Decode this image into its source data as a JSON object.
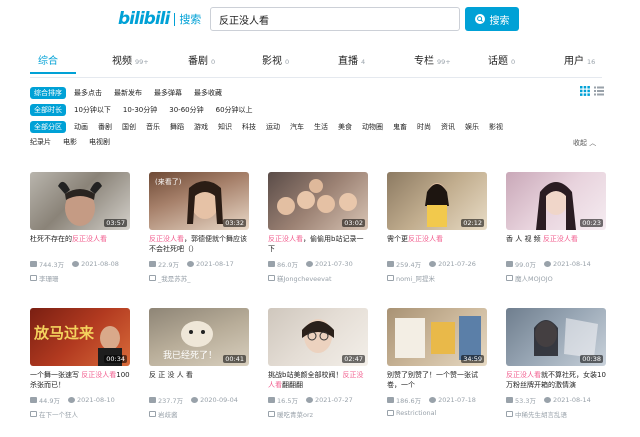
{
  "header": {
    "logo": "bilibili",
    "logo_suffix": "搜索",
    "search_value": "反正没人看",
    "search_button": "搜索"
  },
  "tabs": [
    {
      "label": "综合",
      "count": ""
    },
    {
      "label": "视频",
      "count": "99+"
    },
    {
      "label": "番剧",
      "count": "0"
    },
    {
      "label": "影视",
      "count": "0"
    },
    {
      "label": "直播",
      "count": "4"
    },
    {
      "label": "专栏",
      "count": "99+"
    },
    {
      "label": "话题",
      "count": "0"
    },
    {
      "label": "用户",
      "count": "16"
    }
  ],
  "filters": {
    "sort": {
      "active": "综合排序",
      "options": [
        "最多点击",
        "最新发布",
        "最多弹幕",
        "最多收藏"
      ]
    },
    "duration": {
      "active": "全部时长",
      "options": [
        "10分钟以下",
        "10-30分钟",
        "30-60分钟",
        "60分钟以上"
      ]
    },
    "zone": {
      "active": "全部分区",
      "options": [
        "动画",
        "番剧",
        "国创",
        "音乐",
        "舞蹈",
        "游戏",
        "知识",
        "科技",
        "运动",
        "汽车",
        "生活",
        "美食",
        "动物圈",
        "鬼畜",
        "时尚",
        "资讯",
        "娱乐",
        "影视"
      ]
    },
    "zone_row2": [
      "纪录片",
      "电影",
      "电视剧"
    ],
    "collapse": "收起"
  },
  "keyword": "反正没人看",
  "videos": [
    {
      "duration": "03:57",
      "title_pre": "杜死不存在的",
      "title_kw": "反正没人看",
      "title_post": "",
      "views": "744.3万",
      "date": "2021-08-08",
      "author": "李珊珊"
    },
    {
      "duration": "03:32",
      "title_pre": "",
      "title_kw": "反正没人看",
      "title_post": "，郭德便就个舞应该不会社死吧（）",
      "views": "22.9万",
      "date": "2021-08-17",
      "author": "_我是苏苏_"
    },
    {
      "duration": "03:02",
      "title_pre": "",
      "title_kw": "反正没人看",
      "title_post": "，偷偷用b站记录一下",
      "views": "86.0万",
      "date": "2021-07-30",
      "author": "糕Jongcheveevat"
    },
    {
      "duration": "02:12",
      "title_pre": "需个更",
      "title_kw": "反正没人看",
      "title_post": "",
      "views": "259.4万",
      "date": "2021-07-26",
      "author": "nomi_阿提米"
    },
    {
      "duration": "00:23",
      "title_pre": "香 人 视 频 ",
      "title_kw": "反正没人看",
      "title_post": "",
      "views": "99.0万",
      "date": "2021-08-14",
      "author": "魔人MOJOJO"
    },
    {
      "duration": "00:34",
      "title_pre": "一个舞一张速写 ",
      "title_kw": "反正没人看",
      "title_post": "100杀张而已！",
      "views": "44.9万",
      "date": "2021-08-10",
      "author": "在下一个狂人"
    },
    {
      "duration": "00:41",
      "title_pre": "反 正 没 人 看",
      "title_kw": "",
      "title_post": "",
      "views": "237.7万",
      "date": "2020-09-04",
      "author": "岩歧酱"
    },
    {
      "duration": "02:47",
      "title_pre": "挑战b站美颜全部校阀！",
      "title_kw": "反正没人看",
      "title_post": "翻翻翻",
      "views": "16.5万",
      "date": "2021-07-27",
      "author": "暖吃青菜orz"
    },
    {
      "duration": "34:59",
      "title_pre": "别赞了别赞了！一个赞一张试卷，一个",
      "title_kw": "",
      "title_post": "",
      "views": "186.6万",
      "date": "2021-07-18",
      "author": "Restrictional"
    },
    {
      "duration": "00:38",
      "title_pre": "",
      "title_kw": "反正没人看",
      "title_post": "就不算社死，女装10万粉丝牌开箱的激情演",
      "views": "53.3万",
      "date": "2021-08-14",
      "author": "中稀先生胡言乱语"
    }
  ],
  "colors": {
    "accent": "#00a1d6",
    "keyword": "#f25d8e",
    "muted": "#99a2aa"
  }
}
